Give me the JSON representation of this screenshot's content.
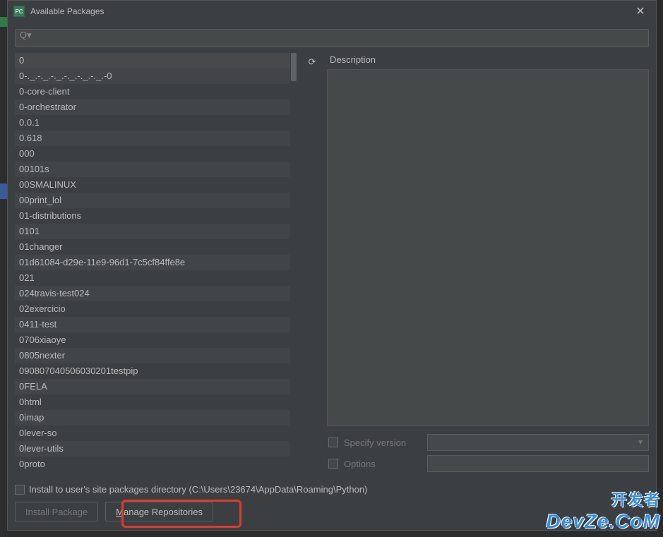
{
  "dialog": {
    "title": "Available Packages",
    "close_glyph": "✕"
  },
  "search": {
    "placeholder": "",
    "icon_glyph": "Q▾"
  },
  "refresh": {
    "glyph": "⟳"
  },
  "packages": [
    "0",
    "0-._.-._.-._.-._.-._.-._.-0",
    "0-core-client",
    "0-orchestrator",
    "0.0.1",
    "0.618",
    "000",
    "00101s",
    "00SMALINUX",
    "00print_lol",
    "01-distributions",
    "0101",
    "01changer",
    "01d61084-d29e-11e9-96d1-7c5cf84ffe8e",
    "021",
    "024travis-test024",
    "02exercicio",
    "0411-test",
    "0706xiaoye",
    "0805nexter",
    "090807040506030201testpip",
    "0FELA",
    "0html",
    "0imap",
    "0lever-so",
    "0lever-utils",
    "0proto"
  ],
  "right": {
    "description_label": "Description",
    "specify_version_label": "Specify version",
    "specify_version_value": "",
    "options_label": "Options",
    "options_value": ""
  },
  "footer": {
    "install_to_user_label": "Install to user's site packages directory (C:\\Users\\23674\\AppData\\Roaming\\Python)",
    "install_button": "Install Package",
    "manage_button": "Manage Repositories",
    "manage_button_underline_char": "M"
  },
  "watermark": {
    "cn": "开发者",
    "en": "DevZe.CoM"
  }
}
